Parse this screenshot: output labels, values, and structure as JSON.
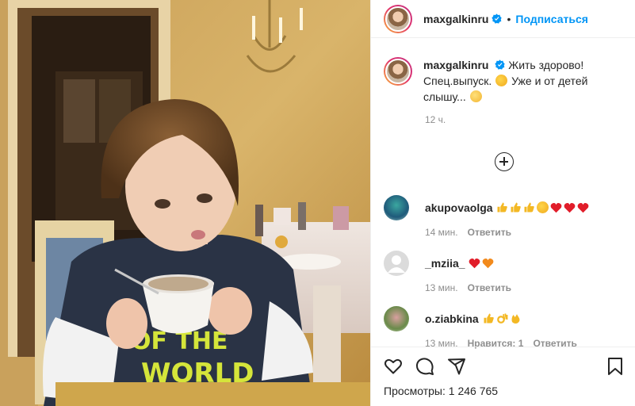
{
  "post": {
    "username": "maxgalkinru",
    "follow_label": "Подписаться",
    "separator": "•",
    "caption_part1": "Жить здорово! Спец.выпуск.",
    "caption_part2": "Уже и от детей слышу...",
    "caption_time": "12 ч.",
    "verified_color": "#0095f6"
  },
  "media": {
    "shirt_text_1": "OF THE",
    "shirt_text_2": "WORLD"
  },
  "comments": [
    {
      "user": "akupovaolga",
      "time": "14 мин.",
      "reply_label": "Ответить",
      "likes_label": ""
    },
    {
      "user": "_mziia_",
      "time": "13 мин.",
      "reply_label": "Ответить",
      "likes_label": ""
    },
    {
      "user": "o.ziabkina",
      "time": "13 мин.",
      "reply_label": "Ответить",
      "likes_label": "Нравится: 1"
    }
  ],
  "footer": {
    "views_label": "Просмотры:",
    "views_count": "1 246 765"
  },
  "icons": {
    "like": "heart-icon",
    "comment": "comment-icon",
    "share": "share-icon",
    "save": "bookmark-icon",
    "more_comments": "plus-circle-icon"
  },
  "colors": {
    "link_blue": "#0095f6",
    "muted": "#8e8e8e",
    "text": "#262626",
    "border": "#efefef"
  }
}
